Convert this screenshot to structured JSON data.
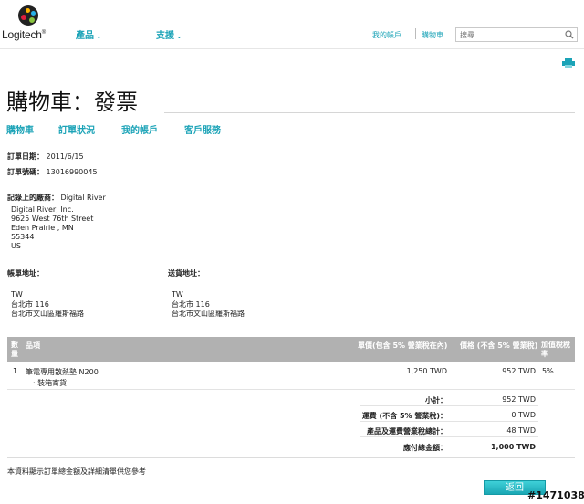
{
  "header": {
    "logo_text": "Logitech",
    "logo_registered": "®",
    "nav": [
      {
        "label": "產品"
      },
      {
        "label": "支援"
      }
    ],
    "links": {
      "account": "我的帳戶",
      "cart": "購物車"
    },
    "search": {
      "placeholder": "搜尋"
    },
    "icons": {
      "search": "search-icon",
      "print": "print-icon",
      "chevron": "chevron-down-icon"
    }
  },
  "page": {
    "title": "購物車：發票",
    "subnav": [
      "購物車",
      "訂單狀況",
      "我的帳戶",
      "客戶服務"
    ]
  },
  "order": {
    "date_label": "訂單日期：",
    "date_value": "2011/6/15",
    "number_label": "訂單號碼：",
    "number_value": "13016990045"
  },
  "merchant": {
    "label": "記錄上的廠商：",
    "name": "Digital River",
    "address": [
      "Digital River, Inc.",
      "9625 West 76th Street",
      "Eden Prairie , MN",
      "55344",
      "US"
    ]
  },
  "billing": {
    "label": "帳單地址：",
    "lines": [
      "TW",
      "台北市 116",
      "台北市文山區羅斯福路"
    ]
  },
  "shipping": {
    "label": "送貨地址：",
    "lines": [
      "TW",
      "台北市 116",
      "台北市文山區羅斯福路"
    ]
  },
  "table": {
    "headers": {
      "qty": "數量",
      "item": "品項",
      "unit_price": "單價(包含 5% 營業稅在內)",
      "price": "價格 (不含 5% 營業稅)",
      "vat_rate": "加值稅稅率"
    },
    "rows": [
      {
        "qty": "1",
        "item": "筆電專用散熱墊 N200",
        "note": "裝箱寄貨",
        "unit_price": "1,250 TWD",
        "price": "952 TWD",
        "vat_rate": "5%"
      }
    ]
  },
  "summary": {
    "subtotal_label": "小計：",
    "subtotal_value": "952 TWD",
    "shipping_label": "運費 (不含 5% 營業稅)：",
    "shipping_value": "0 TWD",
    "tax_label": "產品及運費營業稅總計：",
    "tax_value": "48 TWD",
    "total_label": "應付總金額：",
    "total_value": "1,000 TWD"
  },
  "footer": {
    "note": "本資料顯示訂單總金額及詳細清單供您參考",
    "return_label": "返回",
    "watermark": "#1471038"
  }
}
